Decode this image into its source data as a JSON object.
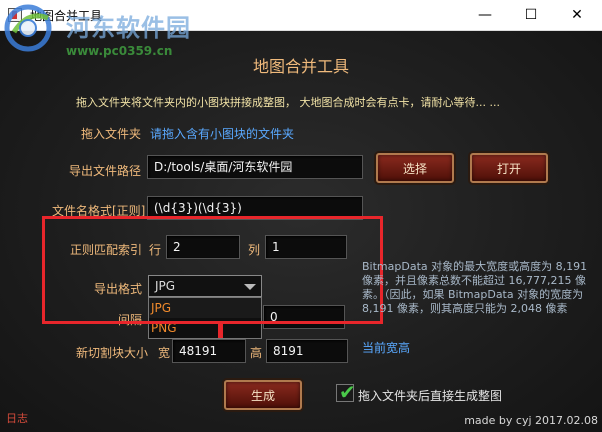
{
  "window": {
    "title": "地图合并工具",
    "minimize": "—",
    "maximize": "☐",
    "close": "✕"
  },
  "watermark": {
    "site_name": "河东软件园",
    "url": "www.pc0359.cn"
  },
  "header": {
    "title": "地图合并工具"
  },
  "intro_text": "拖入文件夹将文件夹内的小图块拼接成整图，  大地图合成时会有点卡，请耐心等待... ...",
  "drag": {
    "label": "拖入文件夹",
    "hint": "请拖入含有小图块的文件夹"
  },
  "export_path": {
    "label": "导出文件路径",
    "value": "D:/tools/桌面/河东软件园",
    "choose_button": "选择",
    "open_button": "打开"
  },
  "filename_format": {
    "label": "文件名格式[正则]",
    "value": "(\\d{3})(\\d{3})"
  },
  "regex_index": {
    "label": "正则匹配索引",
    "row_label": "行",
    "row_value": "2",
    "col_label": "列",
    "col_value": "1"
  },
  "export_format": {
    "label": "导出格式",
    "selected": "JPG",
    "options": [
      "JPG",
      "PNG"
    ]
  },
  "spacing": {
    "label": "间隔",
    "value": "0"
  },
  "new_tile_size": {
    "label": "新切割块大小",
    "width_label": "宽",
    "width_value": "48191",
    "height_label": "高",
    "height_value": "8191",
    "current_link": "当前宽高"
  },
  "info_text": "BitmapData 对象的最大宽度或高度为 8,191 像素，并且像素总数不能超过 16,777,215 像素。（因此，如果 BitmapData 对象的宽度为 8,191 像素，则其高度只能为 2,048 像素",
  "generate_button": "生成",
  "auto_generate": {
    "label": "拖入文件夹后直接生成整图",
    "checked": true
  },
  "footer": {
    "log": "日志",
    "made_by": "made by cyj 2017.02.08"
  },
  "colors": {
    "accent_label": "#f0ba7c",
    "link": "#5aa9ff",
    "highlight_box": "#e8262b",
    "dropdown_option": "#f08a2c"
  }
}
